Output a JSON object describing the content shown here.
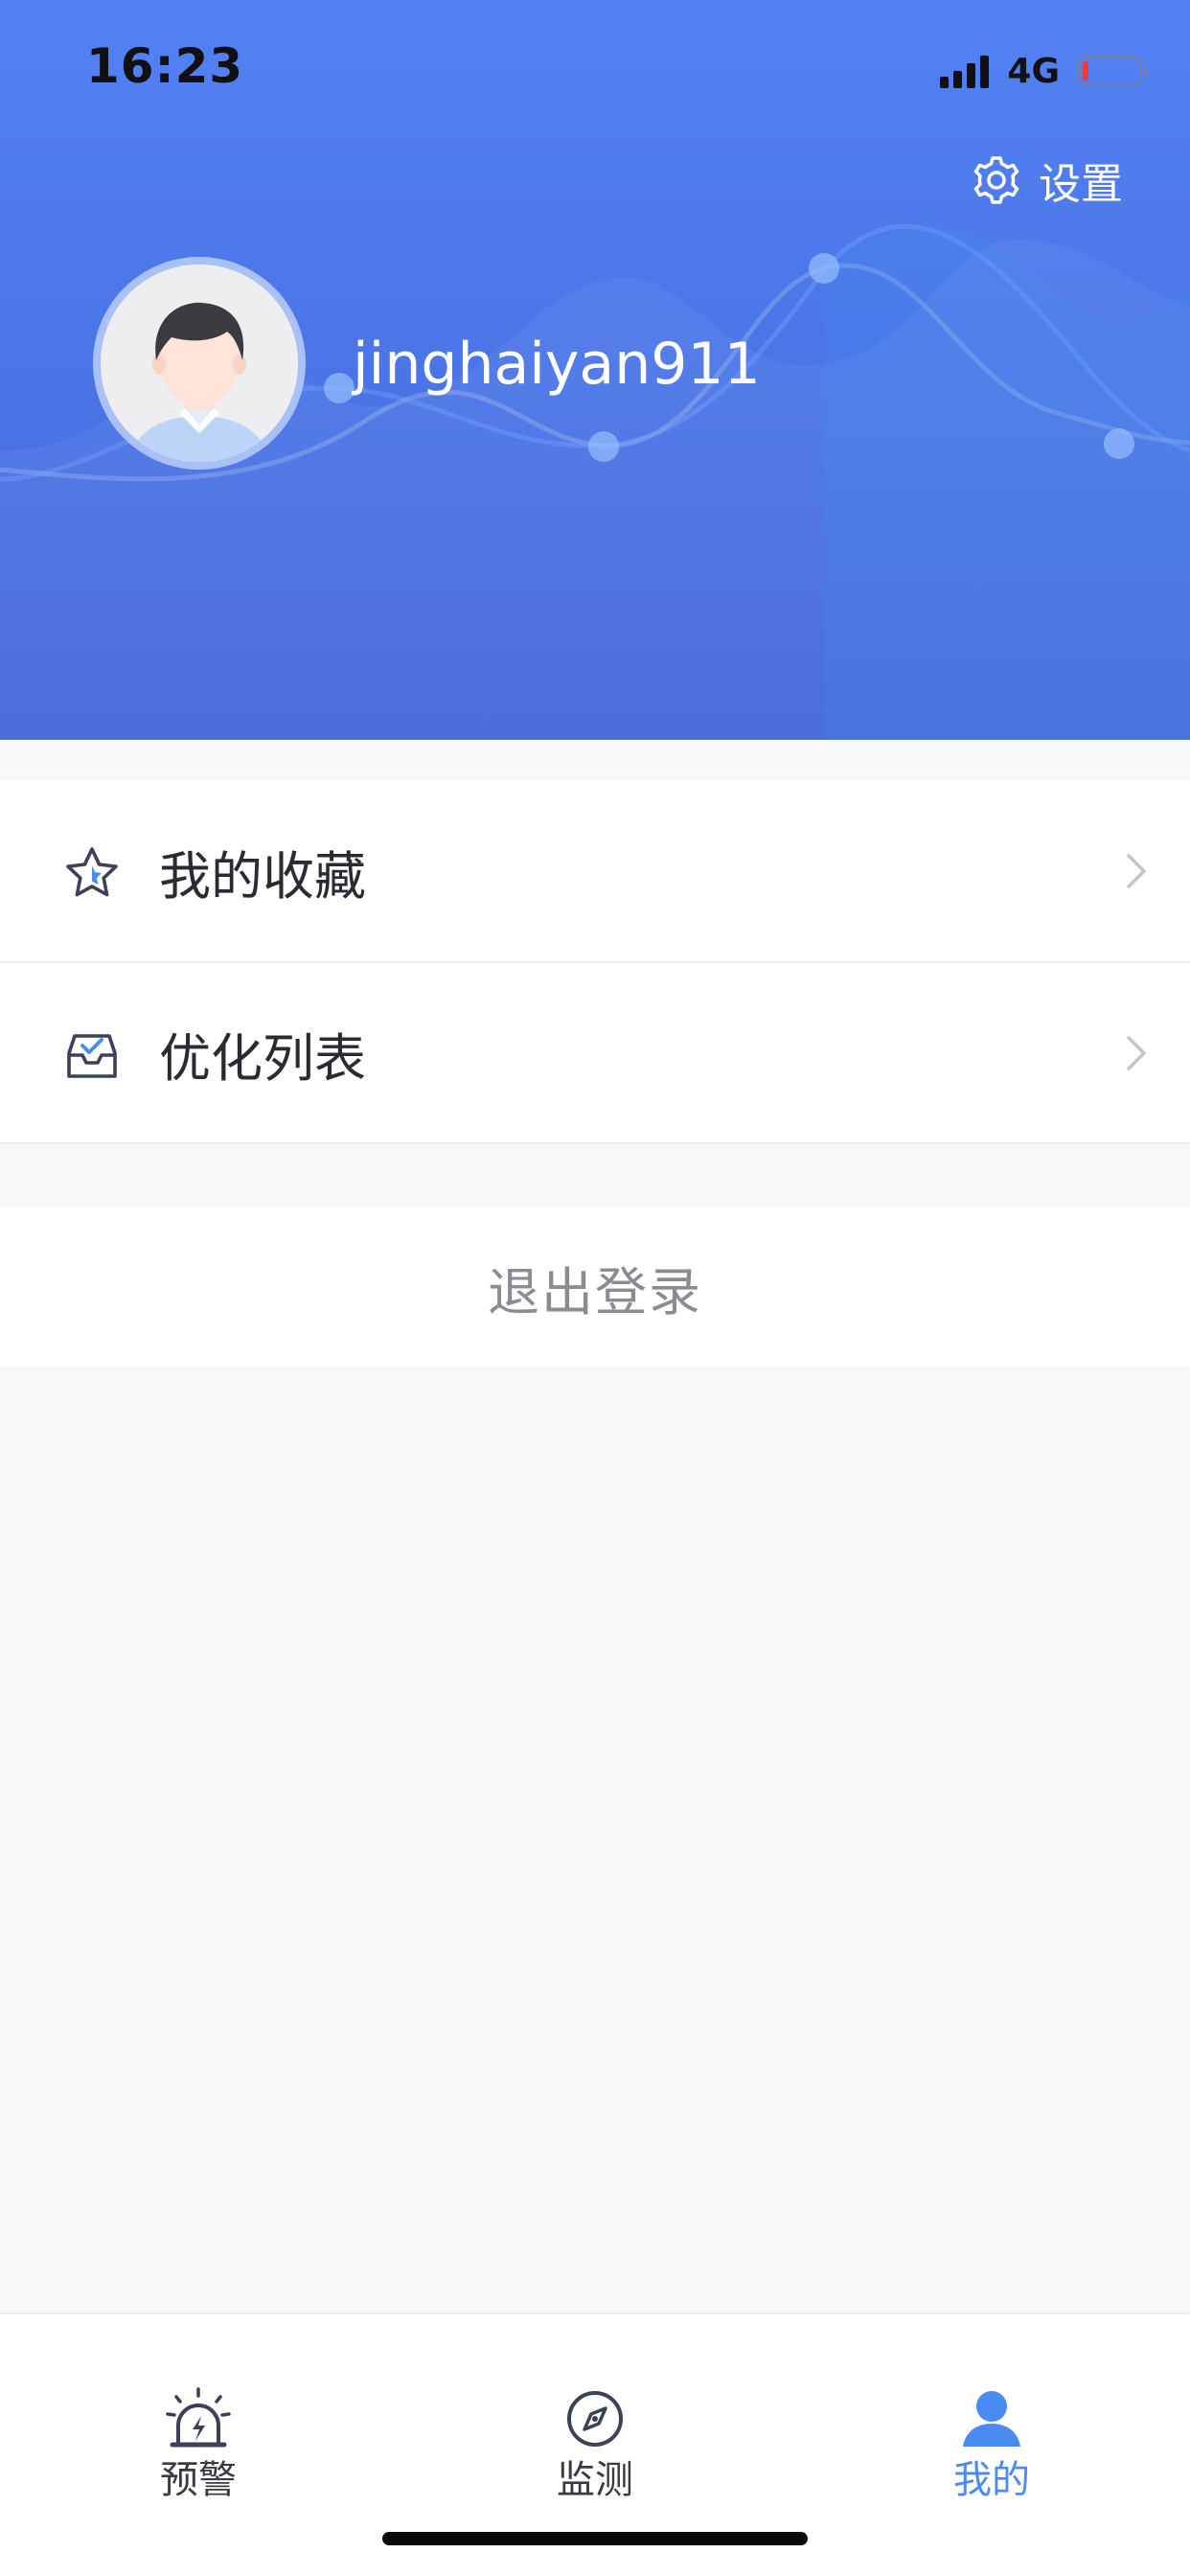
{
  "status_bar": {
    "time": "16:23",
    "network": "4G",
    "battery_level": 0.1,
    "battery_color": "#f03a3a"
  },
  "header": {
    "settings_label": "设置",
    "username": "jinghaiyan911",
    "gradient_top": "#5381f3",
    "gradient_bottom": "#4466d8"
  },
  "menu": {
    "items": [
      {
        "label": "我的收藏",
        "icon": "star-icon"
      },
      {
        "label": "优化列表",
        "icon": "inbox-check-icon"
      }
    ]
  },
  "logout": {
    "label": "退出登录"
  },
  "tabbar": {
    "tabs": [
      {
        "label": "预警",
        "icon": "alarm-light-icon",
        "active": false
      },
      {
        "label": "监测",
        "icon": "compass-icon",
        "active": false
      },
      {
        "label": "我的",
        "icon": "user-icon",
        "active": true
      }
    ],
    "active_color": "#4a8bf2"
  }
}
